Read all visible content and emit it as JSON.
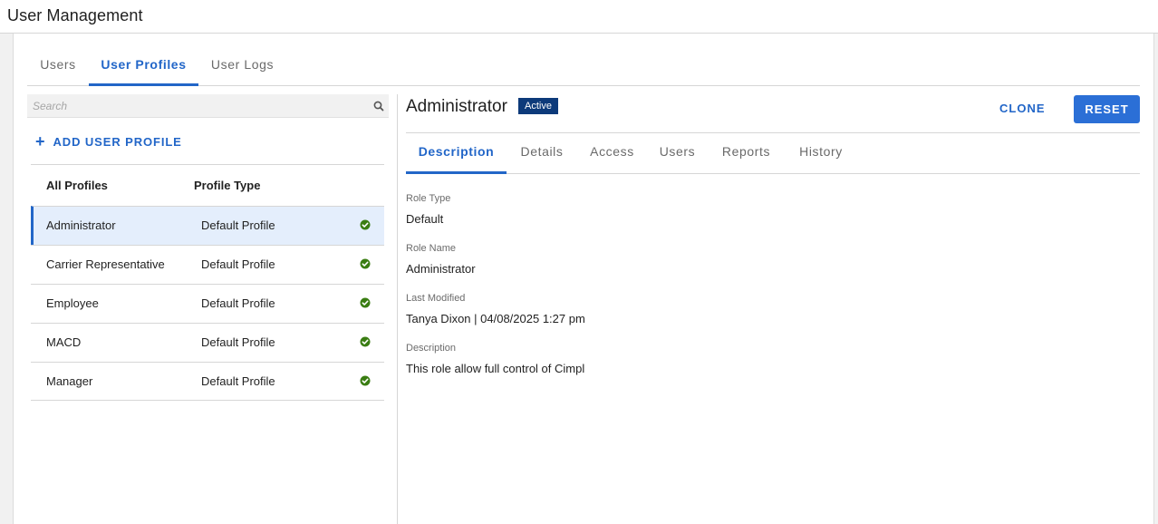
{
  "app": {
    "title": "User Management"
  },
  "top_tabs": [
    {
      "label": "Users",
      "active": false
    },
    {
      "label": "User Profiles",
      "active": true
    },
    {
      "label": "User Logs",
      "active": false
    }
  ],
  "search": {
    "placeholder": "Search",
    "value": ""
  },
  "add_profile": {
    "label": "ADD USER PROFILE"
  },
  "profiles_table": {
    "columns": [
      "All Profiles",
      "Profile Type"
    ],
    "rows": [
      {
        "name": "Administrator",
        "type": "Default Profile",
        "status_icon": "check-circle-icon",
        "selected": true
      },
      {
        "name": "Carrier Representative",
        "type": "Default Profile",
        "status_icon": "check-circle-icon",
        "selected": false
      },
      {
        "name": "Employee",
        "type": "Default Profile",
        "status_icon": "check-circle-icon",
        "selected": false
      },
      {
        "name": "MACD",
        "type": "Default Profile",
        "status_icon": "check-circle-icon",
        "selected": false
      },
      {
        "name": "Manager",
        "type": "Default Profile",
        "status_icon": "check-circle-icon",
        "selected": false
      }
    ]
  },
  "detail": {
    "title": "Administrator",
    "status": "Active",
    "clone_label": "CLONE",
    "reset_label": "RESET",
    "tabs": [
      {
        "label": "Description",
        "active": true
      },
      {
        "label": "Details",
        "active": false
      },
      {
        "label": "Access",
        "active": false
      },
      {
        "label": "Users",
        "active": false
      },
      {
        "label": "Reports",
        "active": false
      },
      {
        "label": "History",
        "active": false
      }
    ],
    "fields": [
      {
        "label": "Role Type",
        "value": "Default"
      },
      {
        "label": "Role Name",
        "value": "Administrator"
      },
      {
        "label": "Last Modified",
        "value": "Tanya Dixon | 04/08/2025 1:27 pm"
      },
      {
        "label": "Description",
        "value": "This role allow full control of Cimpl"
      }
    ]
  },
  "colors": {
    "accent": "#2266c8",
    "badge": "#0d3a7a",
    "check": "#3a7d12",
    "selected_row": "#e4eefc"
  }
}
